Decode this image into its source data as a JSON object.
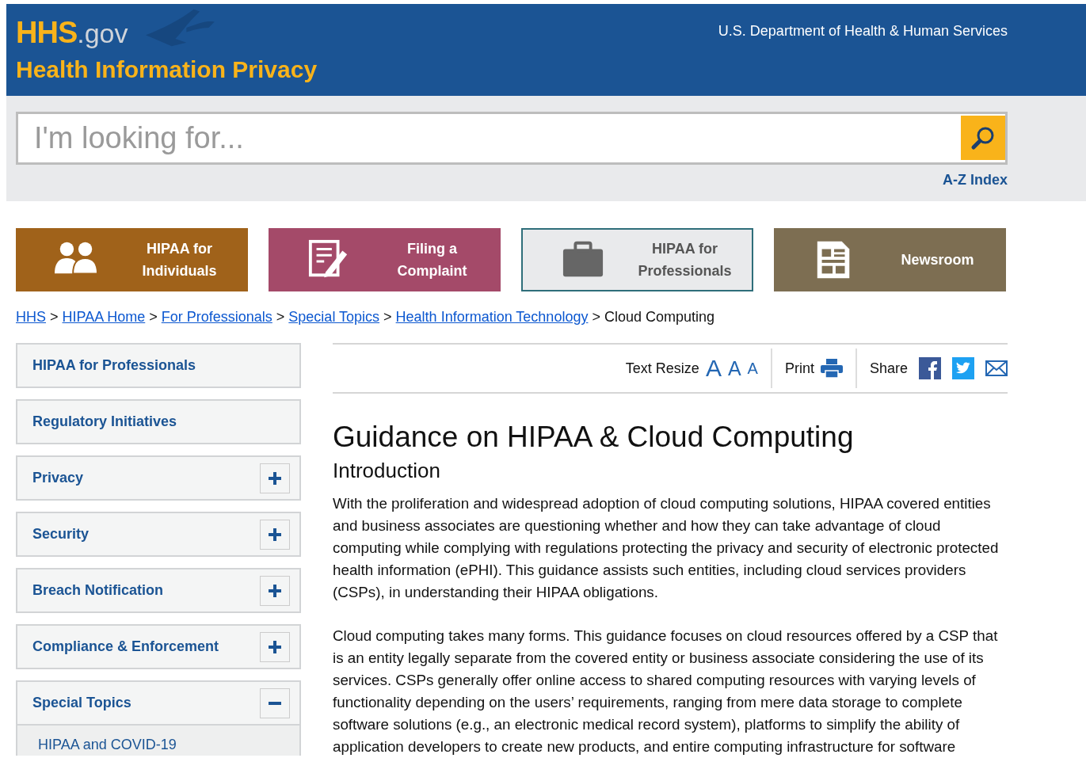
{
  "header": {
    "logo_main": "HHS",
    "logo_suffix": ".gov",
    "site_title": "Health Information Privacy",
    "department": "U.S. Department of Health & Human Services"
  },
  "search": {
    "placeholder": "I'm looking for...",
    "az_index": "A-Z Index"
  },
  "tiles": [
    {
      "kind": "people",
      "label": "HIPAA for\nIndividuals",
      "color": "#a0621a",
      "selected": false
    },
    {
      "kind": "form",
      "label": "Filing a\nComplaint",
      "color": "#a44a69",
      "selected": false
    },
    {
      "kind": "briefcase",
      "label": "HIPAA for\nProfessionals",
      "color": "#2f6e7a",
      "selected": true
    },
    {
      "kind": "newspaper",
      "label": "Newsroom",
      "color": "#7d6e52",
      "selected": false
    }
  ],
  "breadcrumb": {
    "links": [
      "HHS",
      "HIPAA Home",
      "For Professionals",
      "Special Topics",
      "Health Information Technology"
    ],
    "separator": ">",
    "current": "Cloud Computing"
  },
  "sidebar": {
    "items": [
      {
        "kind": "link",
        "label": "HIPAA for Professionals"
      },
      {
        "kind": "link",
        "label": "Regulatory Initiatives"
      },
      {
        "kind": "expandable",
        "label": "Privacy",
        "expanded": false
      },
      {
        "kind": "expandable",
        "label": "Security",
        "expanded": false
      },
      {
        "kind": "expandable",
        "label": "Breach Notification",
        "expanded": false
      },
      {
        "kind": "expandable",
        "label": "Compliance & Enforcement",
        "expanded": false
      },
      {
        "kind": "expandable",
        "label": "Special Topics",
        "expanded": true,
        "children": [
          {
            "label": "HIPAA and COVID-19"
          }
        ]
      }
    ]
  },
  "toolbar": {
    "text_resize": "Text Resize",
    "sizes": [
      "A",
      "A",
      "A"
    ],
    "print": "Print",
    "share": "Share"
  },
  "article": {
    "title": "Guidance on HIPAA & Cloud Computing",
    "subtitle": "Introduction",
    "paragraphs": [
      "With the proliferation and widespread adoption of cloud computing solutions, HIPAA covered entities and business associates are questioning whether and how they can take advantage of cloud computing while complying with regulations protecting the privacy and security of electronic protected health information (ePHI).  This guidance assists such entities, including cloud services providers (CSPs), in understanding their HIPAA obligations.",
      "Cloud computing takes many forms.  This guidance focuses on cloud resources offered by a CSP that is an entity legally separate from the covered entity or business associate considering the use of its services.  CSPs generally offer online access to shared computing resources with varying levels of functionality depending on the users’ requirements, ranging from mere data storage to complete software solutions (e.g., an electronic medical record system), platforms to simplify the ability of application developers to create new products, and entire computing infrastructure for software"
    ]
  }
}
